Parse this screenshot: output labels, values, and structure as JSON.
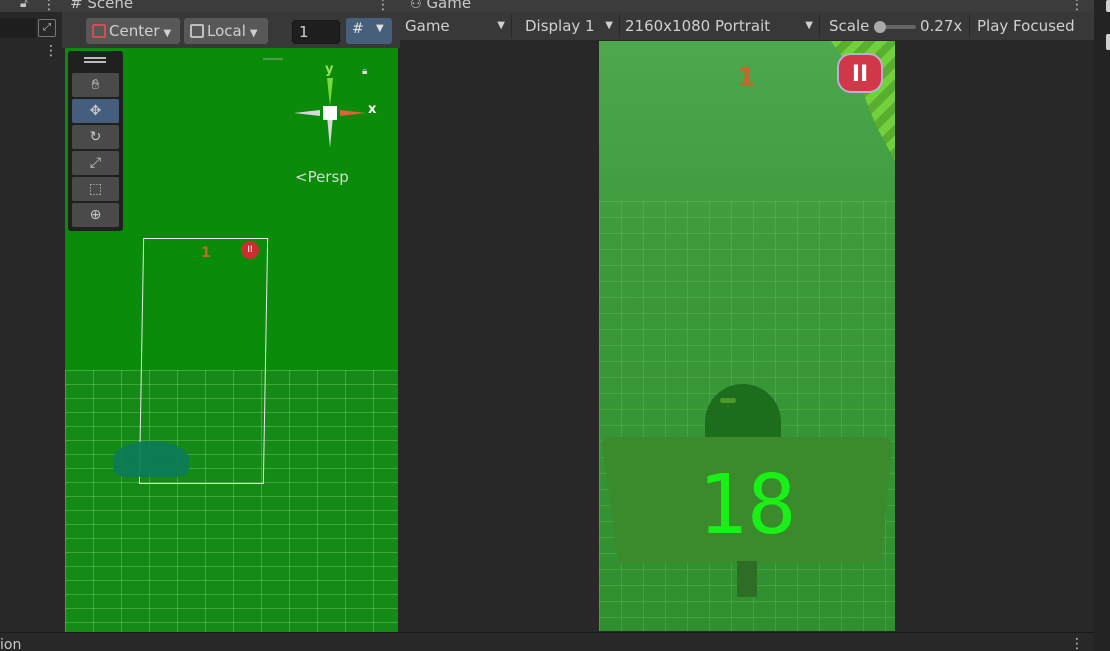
{
  "left_panel": {
    "kebab": "⋮"
  },
  "scene": {
    "tab_label": "# Scene",
    "kebab": "⋮",
    "toolbar": {
      "pivot_label": "Center",
      "space_label": "Local",
      "snap_value": "1"
    },
    "view": {
      "persp_label": "<Persp",
      "gizmo_y": "y",
      "gizmo_x": "x",
      "score_text": "1",
      "pause_glyph": "II"
    },
    "tools": [
      "hand",
      "move",
      "rotate",
      "scale",
      "rect",
      "transform"
    ]
  },
  "game": {
    "tab_label": "Game",
    "kebab": "⋮",
    "toolbar": {
      "mode_label": "Game",
      "display_label": "Display 1",
      "resolution_label": "2160x1080 Portrait",
      "scale_label": "Scale",
      "scale_value": "0.27x",
      "play_focused_label": "Play Focused"
    },
    "view": {
      "score_text": "1",
      "pause_glyph": "II",
      "big_number": "18"
    }
  },
  "bottom_panel": {
    "label": "ion",
    "kebab": "⋮"
  },
  "colors": {
    "scene_bg": "#0a8c0a",
    "game_bg": "#3c9a3c",
    "big_number": "#18f018",
    "score_orange": "#c06a2a",
    "pause_red": "#d03848",
    "active_tool": "#465e7e"
  }
}
